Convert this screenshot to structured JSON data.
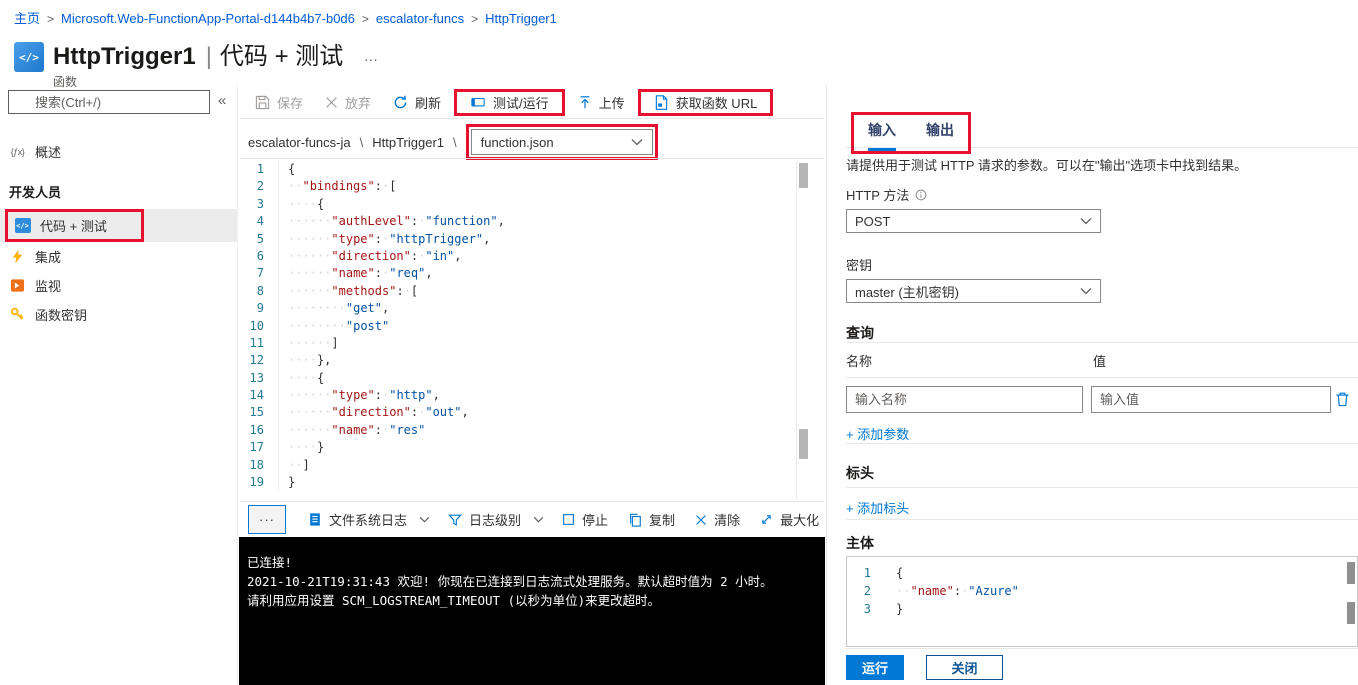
{
  "colors": {
    "annotation_red": "#e8112d",
    "accent_blue": "#0078d4",
    "link_blue": "#015cda",
    "key_red": "#a31515",
    "value_blue": "#0451a5"
  },
  "breadcrumb": {
    "sep": ">",
    "items": [
      "主页",
      "Microsoft.Web-FunctionApp-Portal-d144b4b7-b0d6",
      "escalator-funcs",
      "HttpTrigger1"
    ]
  },
  "header": {
    "title": "HttpTrigger1",
    "divider": "|",
    "context": "代码 + 测试",
    "more": "···",
    "type_label": "函数"
  },
  "sidebar": {
    "search_placeholder": "搜索(Ctrl+/)",
    "collapse": "«",
    "overview": {
      "label": "概述",
      "icon": "fx-overview-icon",
      "glyph": "{ƒx}"
    },
    "section": "开发人员",
    "dev_items": [
      {
        "label": "代码 + 测试",
        "icon": "code-test-icon",
        "selected": true
      },
      {
        "label": "集成",
        "icon": "lightning-icon"
      },
      {
        "label": "监视",
        "icon": "monitor-icon"
      },
      {
        "label": "函数密钥",
        "icon": "key-icon"
      }
    ]
  },
  "toolbar": {
    "buttons": [
      {
        "label": "保存",
        "icon": "save-icon",
        "disabled": true
      },
      {
        "label": "放弃",
        "icon": "discard-x-icon",
        "disabled": true
      },
      {
        "label": "刷新",
        "icon": "refresh-icon"
      },
      {
        "label": "测试/运行",
        "icon": "test-run-icon",
        "annotated": true
      },
      {
        "label": "上传",
        "icon": "upload-icon"
      },
      {
        "label": "获取函数 URL",
        "icon": "get-url-icon",
        "annotated": true
      }
    ]
  },
  "file_breadcrumb": {
    "app": "escalator-funcs-ja",
    "sep": "\\",
    "func": "HttpTrigger1",
    "file": "function.json"
  },
  "code_editor": {
    "lines": [
      "{",
      "  \"bindings\": [",
      "    {",
      "      \"authLevel\": \"function\",",
      "      \"type\": \"httpTrigger\",",
      "      \"direction\": \"in\",",
      "      \"name\": \"req\",",
      "      \"methods\": [",
      "        \"get\",",
      "        \"post\"",
      "      ]",
      "    },",
      "    {",
      "      \"type\": \"http\",",
      "      \"direction\": \"out\",",
      "      \"name\": \"res\"",
      "    }",
      "  ]",
      "}"
    ]
  },
  "console_toolbar": {
    "more": "···",
    "items": [
      {
        "label": "文件系统日志",
        "icon": "log-list-icon",
        "chevron": true
      },
      {
        "label": "日志级别",
        "icon": "filter-icon",
        "chevron": true
      },
      {
        "label": "停止",
        "icon": "stop-icon"
      },
      {
        "label": "复制",
        "icon": "copy-icon"
      },
      {
        "label": "清除",
        "icon": "clear-x-icon"
      },
      {
        "label": "最大化",
        "icon": "maximize-icon"
      }
    ]
  },
  "console": {
    "lines": [
      "已连接!",
      "2021-10-21T19:31:43 欢迎! 你现在已连接到日志流式处理服务。默认超时值为 2 小时。",
      "请利用应用设置 SCM_LOGSTREAM_TIMEOUT (以秒为单位)来更改超时。"
    ]
  },
  "right_panel": {
    "tabs": [
      {
        "label": "输入",
        "active": true
      },
      {
        "label": "输出"
      }
    ],
    "description": "请提供用于测试 HTTP 请求的参数。可以在\"输出\"选项卡中找到结果。",
    "http_method": {
      "label": "HTTP 方法",
      "value": "POST"
    },
    "key": {
      "label": "密钥",
      "value": "master (主机密钥)"
    },
    "query": {
      "title": "查询",
      "name_col": "名称",
      "value_col": "值",
      "name_placeholder": "输入名称",
      "value_placeholder": "输入值",
      "add": "+ 添加参数"
    },
    "headers": {
      "title": "标头",
      "add": "+ 添加标头"
    },
    "body": {
      "title": "主体",
      "lines": [
        "{",
        "  \"name\": \"Azure\"",
        "}"
      ]
    },
    "footer": {
      "run": "运行",
      "close": "关闭"
    }
  }
}
